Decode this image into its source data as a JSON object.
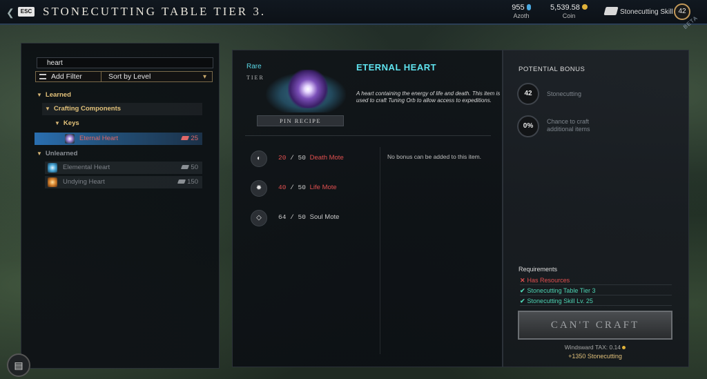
{
  "header": {
    "esc_label": "ESC",
    "title": "STONECUTTING TABLE TIER 3.",
    "azoth_value": "955",
    "azoth_label": "Azoth",
    "coin_value": "5,539.58",
    "coin_label": "Coin",
    "skill_label": "Stonecutting Skill",
    "skill_level": "42",
    "beta_label": "BETA"
  },
  "left_panel": {
    "search_value": "heart",
    "add_filter_label": "Add Filter",
    "sort_label": "Sort by Level",
    "learned_label": "Learned",
    "crafting_components_label": "Crafting Components",
    "keys_label": "Keys",
    "learned_items": [
      {
        "name": "Eternal Heart",
        "count": "25"
      }
    ],
    "unlearned_label": "Unlearned",
    "unlearned_items": [
      {
        "name": "Elemental Heart",
        "count": "50"
      },
      {
        "name": "Undying Heart",
        "count": "150"
      }
    ]
  },
  "item": {
    "rarity": "Rare",
    "tier_label": "TIER",
    "pin_label": "PIN RECIPE",
    "name": "ETERNAL HEART",
    "description": "A heart containing the energy of life and death. This item is used to craft Tuning Orb to allow access to expeditions.",
    "no_bonus_text": "No bonus can be added to this item."
  },
  "ingredients": [
    {
      "have": "20",
      "need": "50",
      "name": "Death Mote",
      "insufficient": true
    },
    {
      "have": "40",
      "need": "50",
      "name": "Life Mote",
      "insufficient": true
    },
    {
      "have": "64",
      "need": "50",
      "name": "Soul Mote",
      "insufficient": false
    }
  ],
  "right_panel": {
    "potential_bonus_label": "POTENTIAL BONUS",
    "skill_bonus_value": "42",
    "skill_bonus_label": "Stonecutting",
    "chance_value": "0%",
    "chance_label": "Chance to craft additional items",
    "requirements_label": "Requirements",
    "requirements": [
      {
        "text": "Has Resources",
        "met": false
      },
      {
        "text": "Stonecutting Table Tier 3",
        "met": true
      },
      {
        "text": "Stonecutting Skill Lv. 25",
        "met": true
      }
    ],
    "craft_button_label": "CAN'T CRAFT",
    "tax_text": "Windsward TAX: 0.14",
    "xp_text": "+1350 Stonecutting"
  },
  "colors": {
    "accent_cyan": "#5fe3ef",
    "danger_red": "#e04f4f",
    "success_teal": "#4dd3b3",
    "selection_blue": "#2a6fb0"
  }
}
